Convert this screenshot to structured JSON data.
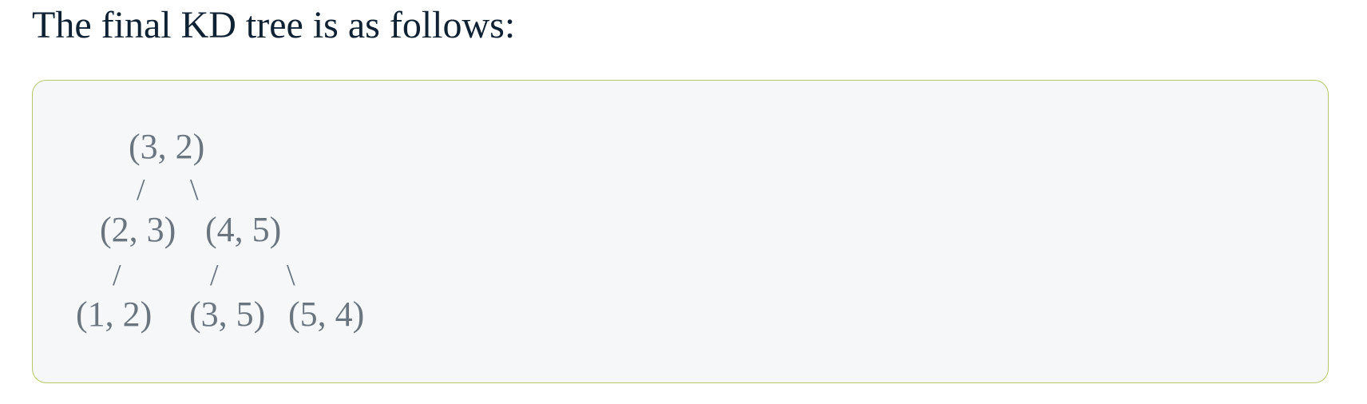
{
  "heading": "The final KD tree is as follows:",
  "tree": {
    "root": "(3, 2)",
    "level1_left": "(2, 3)",
    "level1_right": "(4, 5)",
    "level2_a": "(1, 2)",
    "level2_b": "(3, 5)",
    "level2_c": "(5, 4)",
    "edge_forward": "/",
    "edge_back": "\\"
  }
}
